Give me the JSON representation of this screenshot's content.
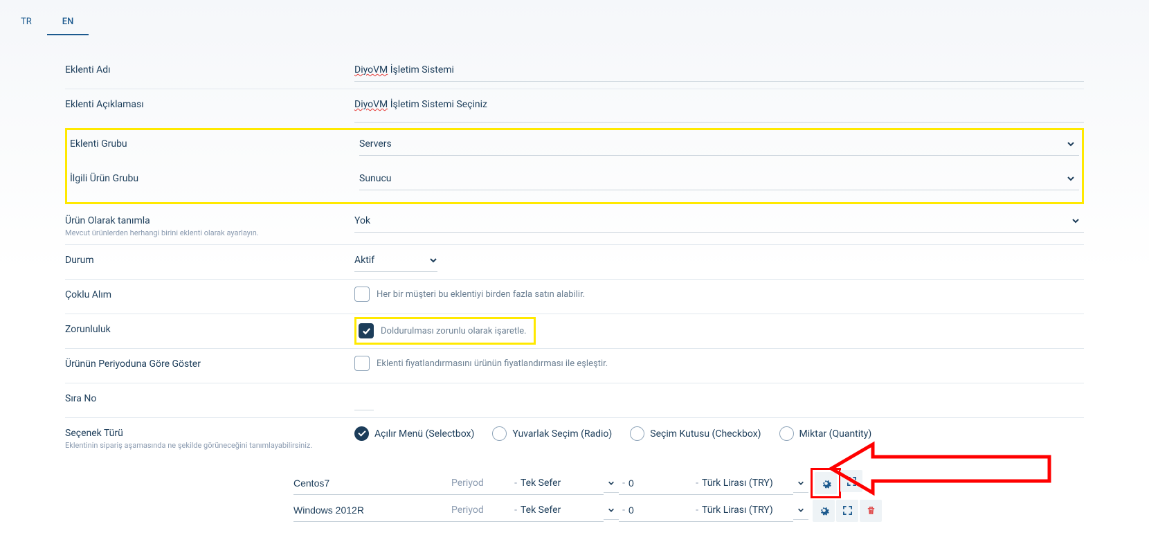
{
  "tabs": {
    "tr": "TR",
    "en": "EN"
  },
  "fields": {
    "name": {
      "label": "Eklenti Adı",
      "value_pre": "DiyoVM",
      "value_post": " İşletim Sistemi"
    },
    "desc": {
      "label": "Eklenti Açıklaması",
      "value_pre": "DiyoVM",
      "value_post": " İşletim Sistemi Seçiniz"
    },
    "group": {
      "label": "Eklenti Grubu",
      "value": "Servers"
    },
    "product_group": {
      "label": "İlgili Ürün Grubu",
      "value": "Sunucu"
    },
    "define_as_product": {
      "label": "Ürün Olarak tanımla",
      "sublabel": "Mevcut ürünlerden herhangi birini eklenti olarak ayarlayın.",
      "value": "Yok"
    },
    "status": {
      "label": "Durum",
      "value": "Aktif"
    },
    "multi": {
      "label": "Çoklu Alım",
      "check_label": "Her bir müşteri bu eklentiyi birden fazla satın alabilir."
    },
    "required": {
      "label": "Zorunluluk",
      "check_label": "Doldurulması zorunlu olarak işaretle."
    },
    "period_match": {
      "label": "Ürünün Periyoduna Göre Göster",
      "check_label": "Eklenti fiyatlandırmasını ürünün fiyatlandırması ile eşleştir."
    },
    "order_no": {
      "label": "Sıra No"
    },
    "option_type": {
      "label": "Seçenek Türü",
      "sublabel": "Eklentinin sipariş aşamasında ne şekilde görüneceğini tanımlayabilirsiniz.",
      "options": {
        "selectbox": "Açılır Menü (Selectbox)",
        "radio": "Yuvarlak Seçim (Radio)",
        "checkbox": "Seçim Kutusu (Checkbox)",
        "quantity": "Miktar (Quantity)"
      }
    }
  },
  "option_rows": {
    "period_label": "Periyod",
    "period_value": "Tek Sefer",
    "currency": "Türk Lirası (TRY)",
    "rows": [
      {
        "name": "Centos7",
        "price": "0"
      },
      {
        "name": "Windows 2012R",
        "price": "0"
      }
    ]
  }
}
